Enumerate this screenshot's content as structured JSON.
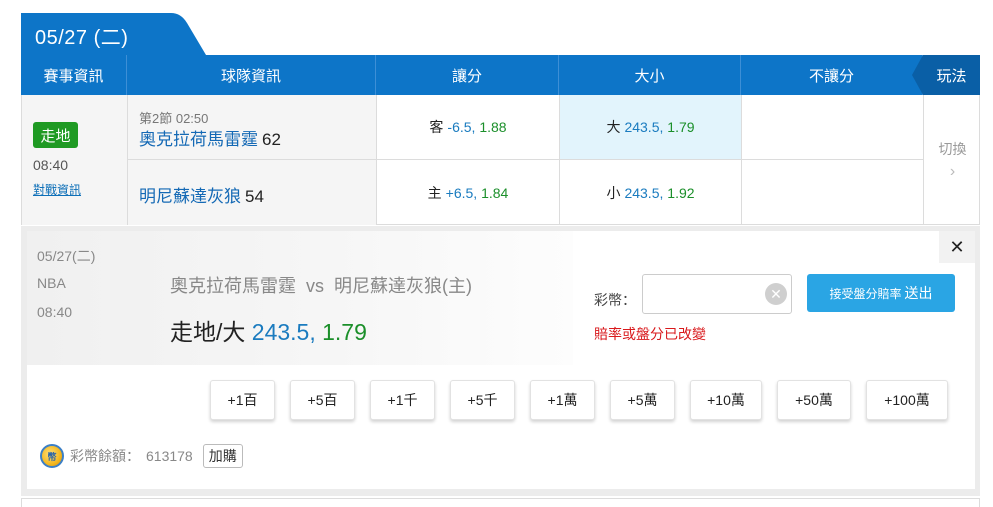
{
  "date_tab": {
    "label": "05/27 (二)"
  },
  "header": {
    "columns": [
      "賽事資訊",
      "球隊資訊",
      "讓分",
      "大小",
      "不讓分"
    ],
    "play_label": "玩法"
  },
  "game": {
    "status": "走地",
    "time": "08:40",
    "h2h_link": "對戰資訊",
    "period": "第2節 02:50",
    "away": {
      "name": "奧克拉荷馬雷霆",
      "score": "62"
    },
    "home": {
      "name": "明尼蘇達灰狼",
      "score": "54"
    },
    "spread": [
      {
        "key": "客",
        "handicap": "-6.5,",
        "odds": "1.88"
      },
      {
        "key": "主",
        "handicap": "+6.5,",
        "odds": "1.84"
      }
    ],
    "total": [
      {
        "key": "大",
        "handicap": "243.5,",
        "odds": "1.79",
        "selected": true
      },
      {
        "key": "小",
        "handicap": "243.5,",
        "odds": "1.92",
        "selected": false
      }
    ],
    "switch": {
      "label": "切換",
      "icon": "chevron-right-icon"
    }
  },
  "slip": {
    "date": "05/27(二)",
    "league": "NBA",
    "time": "08:40",
    "away_team": "奧克拉荷馬雷霆",
    "vs": "vs",
    "home_team": "明尼蘇達灰狼(主)",
    "pick_label": "走地/大",
    "pick_handicap": "243.5,",
    "pick_odds": "1.79",
    "close_icon": "close-icon",
    "stake_label": "彩幣：",
    "stake_value": "",
    "clear_icon": "clear-icon",
    "submit_small": "接受盤分賠率",
    "submit_big": "送出",
    "warning": "賠率或盤分已改變",
    "chips": [
      "+1百",
      "+5百",
      "+1千",
      "+5千",
      "+1萬",
      "+5萬",
      "+10萬",
      "+50萬",
      "+100萬"
    ],
    "balance_label": "彩幣餘額：",
    "balance_value": "613178",
    "topup_label": "加購",
    "coin_icon": "coin-icon"
  },
  "colors": {
    "header_blue": "#0d75c8",
    "live_green": "#1f9a23",
    "odds_green": "#1b8f2a",
    "handicap_blue": "#1a7bbf",
    "submit_blue": "#2aa5e4",
    "warning_red": "#d9191c",
    "selected_cell": "#e2f4fc"
  }
}
